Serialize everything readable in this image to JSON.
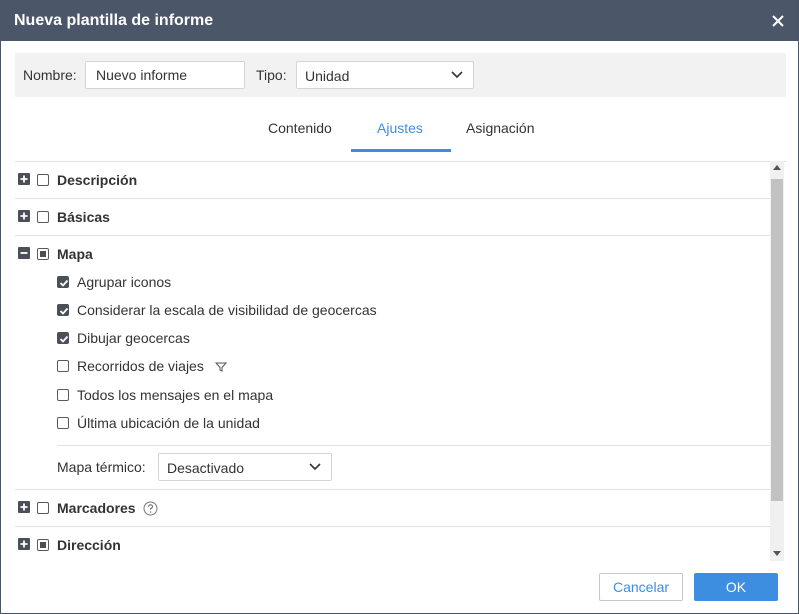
{
  "window": {
    "title": "Nueva plantilla de informe"
  },
  "form": {
    "name_label": "Nombre:",
    "name_value": "Nuevo informe",
    "type_label": "Tipo:",
    "type_value": "Unidad"
  },
  "tabs": [
    {
      "label": "Contenido",
      "active": false
    },
    {
      "label": "Ajustes",
      "active": true
    },
    {
      "label": "Asignación",
      "active": false
    }
  ],
  "sections": {
    "descripcion": {
      "title": "Descripción",
      "expanded": false,
      "checkbox": "unchecked"
    },
    "basicas": {
      "title": "Básicas",
      "expanded": false,
      "checkbox": "unchecked"
    },
    "mapa": {
      "title": "Mapa",
      "expanded": true,
      "checkbox": "partial",
      "options": [
        {
          "label": "Agrupar iconos",
          "checked": true
        },
        {
          "label": "Considerar la escala de visibilidad de geocercas",
          "checked": true
        },
        {
          "label": "Dibujar geocercas",
          "checked": true
        },
        {
          "label": "Recorridos de viajes",
          "checked": false,
          "icon": "filter-icon"
        },
        {
          "label": "Todos los mensajes en el mapa",
          "checked": false
        },
        {
          "label": "Última ubicación de la unidad",
          "checked": false
        }
      ],
      "heatmap_label": "Mapa térmico:",
      "heatmap_value": "Desactivado"
    },
    "marcadores": {
      "title": "Marcadores",
      "expanded": false,
      "checkbox": "unchecked",
      "icon": "help-icon"
    },
    "direccion": {
      "title": "Dirección",
      "expanded": false,
      "checkbox": "partial"
    }
  },
  "footer": {
    "cancel_label": "Cancelar",
    "ok_label": "OK"
  },
  "colors": {
    "titlebar": "#4b5769",
    "accent": "#3d8ee0",
    "toprow_bg": "#f2f2f2"
  }
}
